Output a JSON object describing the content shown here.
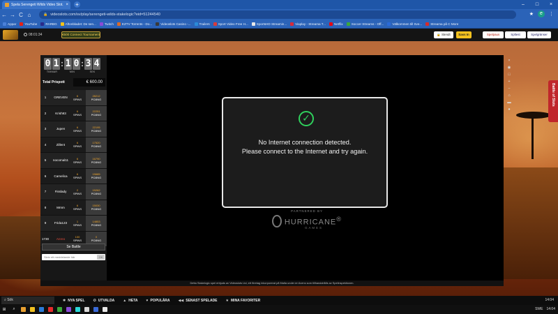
{
  "browser": {
    "tab_title": "Spela Serengeti Wilds Video Slot...",
    "tab_close": "×",
    "new_tab": "+",
    "win_min": "–",
    "win_max": "□",
    "win_close": "×",
    "url": "videoslots.com/sv/play/serengeti-wilds-stakelogic?eid=51244540",
    "back": "←",
    "forward": "→",
    "reload": "C",
    "home": "⌂",
    "lock": "🔒",
    "star": "★",
    "profile": "e",
    "menu": "⋮"
  },
  "bookmarks": [
    {
      "label": "Appar",
      "color": "#4a80d8"
    },
    {
      "label": "YouTube",
      "color": "#e62117"
    },
    {
      "label": "RARBG",
      "color": "#2a2a8a"
    },
    {
      "label": "Aftonbladet: De sen...",
      "color": "#f2c21a"
    },
    {
      "label": "Twitch",
      "color": "#8a4ad8"
    },
    {
      "label": "EZTV Torrents - Do...",
      "color": "#d86a2a"
    },
    {
      "label": "Videoslots Casino -...",
      "color": "#3a3a3a"
    },
    {
      "label": "Trailers",
      "color": "#2a8ad8"
    },
    {
      "label": "Sport Video Free H...",
      "color": "#d83a3a"
    },
    {
      "label": "SportsHD Streamin...",
      "color": "#e8e8e8"
    },
    {
      "label": "Viaplay - Streama T...",
      "color": "#d82a3a"
    },
    {
      "label": "Netflix",
      "color": "#e50914"
    },
    {
      "label": "Soccer Streams - Off...",
      "color": "#3aa83a"
    },
    {
      "label": "Välkommen till Sve...",
      "color": "#2a6ad8"
    },
    {
      "label": "Streama på C More",
      "color": "#d82a2a"
    }
  ],
  "site": {
    "clock": "08:01:34",
    "promo": "€500 Connect Tournament",
    "stendt": "🔒 Stendt",
    "login": "Sass In",
    "pause": "Spelpaus",
    "test": "Spltest",
    "limits": "Spelgränser",
    "side_tab": "Battle of Slots"
  },
  "tournament": {
    "hours": [
      "0",
      "1"
    ],
    "minutes": [
      "1",
      "0"
    ],
    "seconds": [
      "3",
      "4"
    ],
    "hours_label": "TIMMAR",
    "minutes_label": "MIN",
    "seconds_label": "SEK",
    "colon": ":",
    "prize_label": "Total Prispott",
    "prize_value": "€ 600.00",
    "spins_label": "SPINS",
    "points_label": "POÄNG",
    "players": [
      {
        "rank": "1",
        "name": "GREVEN",
        "spins": "6",
        "points": "28212"
      },
      {
        "rank": "2",
        "name": "Krish93",
        "spins": "6",
        "points": "22251"
      },
      {
        "rank": "3",
        "name": "Jupen",
        "spins": "6",
        "points": "22195"
      },
      {
        "rank": "4",
        "name": "Ziller4",
        "spins": "6",
        "points": "17520"
      },
      {
        "rank": "5",
        "name": "nocomal11",
        "spins": "6",
        "points": "16790"
      },
      {
        "rank": "6",
        "name": "Camelica",
        "spins": "6",
        "points": "15685"
      },
      {
        "rank": "7",
        "name": "Fisslady",
        "spins": "2",
        "points": "15262"
      },
      {
        "rank": "8",
        "name": "Mrnm",
        "spins": "6",
        "points": "15030"
      },
      {
        "rank": "9",
        "name": "Frida123",
        "spins": "1",
        "points": "14853"
      },
      {
        "rank": "1730",
        "name": "Anreo",
        "spins": "100",
        "points": "0",
        "me": true
      }
    ],
    "battle_button": "Se Battle",
    "chat_placeholder": "Skriv ett meddelande här",
    "chat_send": "OK"
  },
  "tools": [
    "×",
    "◉",
    "□",
    "+",
    "−",
    "⌂",
    "▬",
    "●"
  ],
  "dialog": {
    "icon": "✓",
    "line1": "No Internet connection detected.",
    "line2": "Please connect to the Internet and try again."
  },
  "partner": {
    "by": "PARTNERED BY",
    "name": "HURRICANE",
    "reg": "®",
    "sub": "GAMES"
  },
  "disclaimer": "Detta Stakelogic spel erbjuds av Videoslots Ltd, ett företag inkorporerat på Malta under en licens som tillhandahålls av Spelinspektionen.",
  "bottom_nav": {
    "search": "Sök",
    "items": [
      {
        "icon": "✱",
        "label": "NYA SPEL"
      },
      {
        "icon": "✪",
        "label": "UTVALDA"
      },
      {
        "icon": "▲",
        "label": "HETA"
      },
      {
        "icon": "♥",
        "label": "POPULÄRA"
      },
      {
        "icon": "◀◀",
        "label": "SENAST SPELADE"
      },
      {
        "icon": "★",
        "label": "MINA FAVORITER"
      }
    ],
    "time": "14:04"
  },
  "taskbar": {
    "start": "⊞",
    "search": "⌕",
    "apps": [
      "#e8a030",
      "#f0c020",
      "#2a7ad8",
      "#e82a2a",
      "#3aa83a",
      "#8a4ad8",
      "#2ad8d8",
      "#d8d8d8",
      "#3a6ad8",
      "#e8e8e8"
    ],
    "tray_lang": "SWE",
    "tray_time": "14:04"
  }
}
